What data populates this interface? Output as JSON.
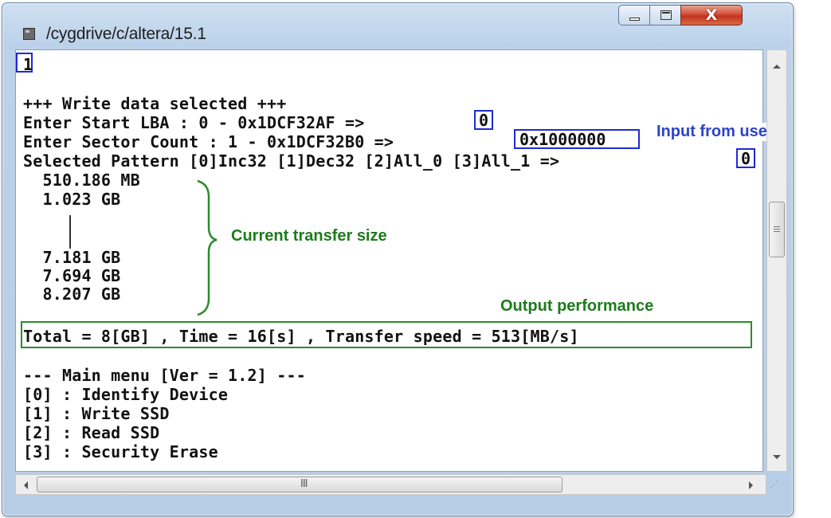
{
  "window": {
    "title": "/cygdrive/c/altera/15.1",
    "buttons": {
      "minimize": "minimize",
      "maximize": "maximize",
      "close": "X"
    }
  },
  "console": {
    "lines": [
      "1",
      "",
      "+++ Write data selected +++",
      "Enter Start LBA : 0 - 0x1DCF32AF => ",
      "Enter Sector Count : 1 - 0x1DCF32B0 => ",
      "Selected Pattern [0]Inc32 [1]Dec32 [2]All_0 [3]All_1 => ",
      "  510.186 MB",
      "  1.023 GB",
      "",
      "",
      "  7.181 GB",
      "  7.694 GB",
      "  8.207 GB",
      "",
      "Total = 8[GB] , Time = 16[s] , Transfer speed = 513[MB/s]",
      "",
      "--- Main menu [Ver = 1.2] ---",
      "[0] : Identify Device",
      "[1] : Write SSD",
      "[2] : Read SSD",
      "[3] : Security Erase"
    ],
    "inputs": {
      "first": "1",
      "start_lba": "0",
      "sector_count": "0x1000000",
      "pattern": "0"
    }
  },
  "annotations": {
    "input_from_user": "Input from user",
    "current_transfer_size": "Current transfer size",
    "output_performance": "Output performance",
    "blue": "#2c43c9",
    "green": "#1d7b1d"
  },
  "scrollbars": {
    "hscroll_grip": "III"
  }
}
